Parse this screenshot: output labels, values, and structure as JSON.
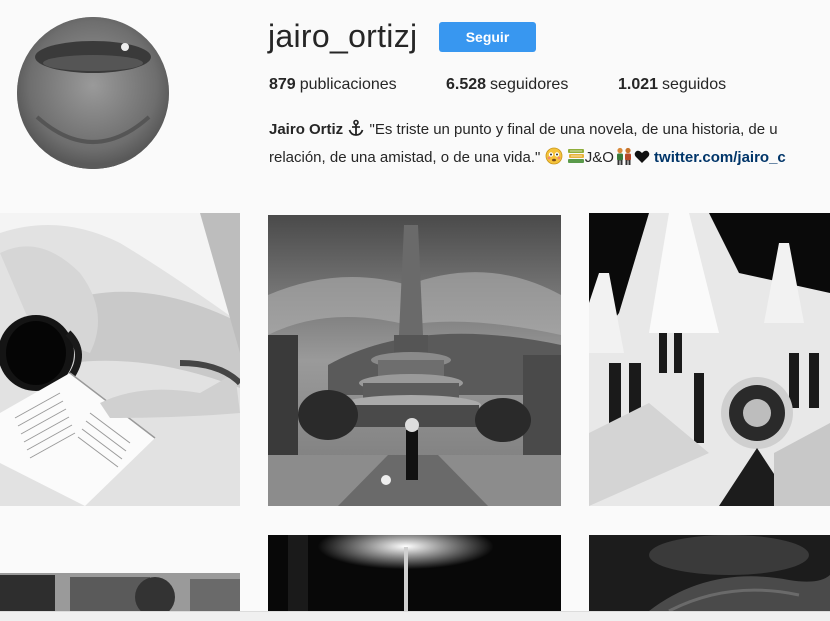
{
  "profile": {
    "username": "jairo_ortizj",
    "follow_label": "Seguir",
    "stats": [
      {
        "count": "879",
        "label": "publicaciones"
      },
      {
        "count": "6.528",
        "label": "seguidores"
      },
      {
        "count": "1.021",
        "label": "seguidos"
      }
    ],
    "bio": {
      "name": "Jairo Ortiz",
      "line1": "\"Es triste un punto y final de una novela, de una historia, de u",
      "line2": "relación, de una amistad, o de una vida.\"",
      "initials": "J&O",
      "link": "twitter.com/jairo_c"
    }
  },
  "icons": {
    "anchor": "anchor-icon",
    "flushed_face": "flushed-face-icon",
    "books": "books-icon",
    "couple": "couple-icon",
    "heart": "black-heart-icon"
  },
  "colors": {
    "accent": "#3897f0",
    "link": "#003569",
    "background": "#fafafa"
  },
  "grid": {
    "posts": [
      {
        "subject": "coffee cup and book on lap"
      },
      {
        "subject": "obelisk plaza"
      },
      {
        "subject": "gothic church"
      },
      {
        "subject": "street scene"
      },
      {
        "subject": "night street lamp"
      },
      {
        "subject": "dark close-up"
      }
    ]
  }
}
